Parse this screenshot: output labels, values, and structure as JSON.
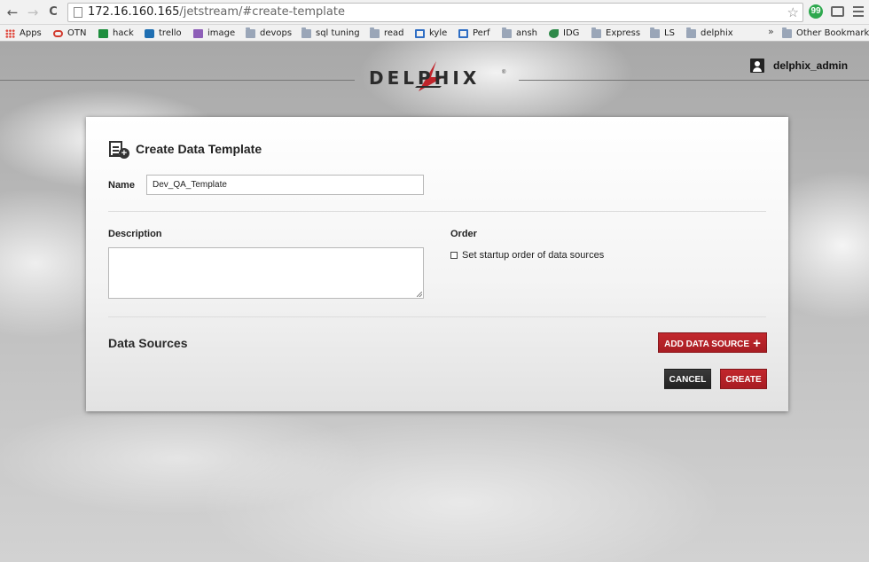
{
  "browser": {
    "url_host": "172.16.160.165",
    "url_path": "/jetstream/#create-template",
    "nav_back": "←",
    "nav_forward": "→",
    "nav_reload": "C",
    "star_glyph": "☆",
    "ext_label": "99",
    "bookmarks": [
      {
        "label": "Apps",
        "icon": "apps-icon"
      },
      {
        "label": "OTN",
        "icon": "otn-icon"
      },
      {
        "label": "hack",
        "icon": "sheet-icon"
      },
      {
        "label": "trello",
        "icon": "trello-icon"
      },
      {
        "label": "image",
        "icon": "image-icon"
      },
      {
        "label": "devops",
        "icon": "folder-icon"
      },
      {
        "label": "sql tuning",
        "icon": "folder-icon"
      },
      {
        "label": "read",
        "icon": "folder-icon"
      },
      {
        "label": "kyle",
        "icon": "page-icon"
      },
      {
        "label": "Perf",
        "icon": "page-icon"
      },
      {
        "label": "ansh",
        "icon": "folder-icon"
      },
      {
        "label": "IDG",
        "icon": "idg-icon"
      },
      {
        "label": "Express",
        "icon": "folder-icon"
      },
      {
        "label": "LS",
        "icon": "folder-icon"
      },
      {
        "label": "delphix",
        "icon": "folder-icon"
      }
    ],
    "bookmarks_more": "»",
    "other_bookmarks": "Other Bookmarks"
  },
  "header": {
    "logo_text": "DELPHIX",
    "logo_tm": "®",
    "user_name": "delphix_admin"
  },
  "dialog": {
    "title": "Create Data Template",
    "name_label": "Name",
    "name_value": "Dev_QA_Template",
    "description_label": "Description",
    "description_value": "",
    "order_label": "Order",
    "order_checkbox_label": "Set startup order of data sources",
    "order_checked": false,
    "data_sources_title": "Data Sources",
    "add_data_source_label": "ADD DATA SOURCE",
    "add_plus": "+",
    "cancel_label": "CANCEL",
    "create_label": "CREATE"
  },
  "colors": {
    "accent_red": "#b8232a",
    "dark_button": "#2c2c2c"
  }
}
